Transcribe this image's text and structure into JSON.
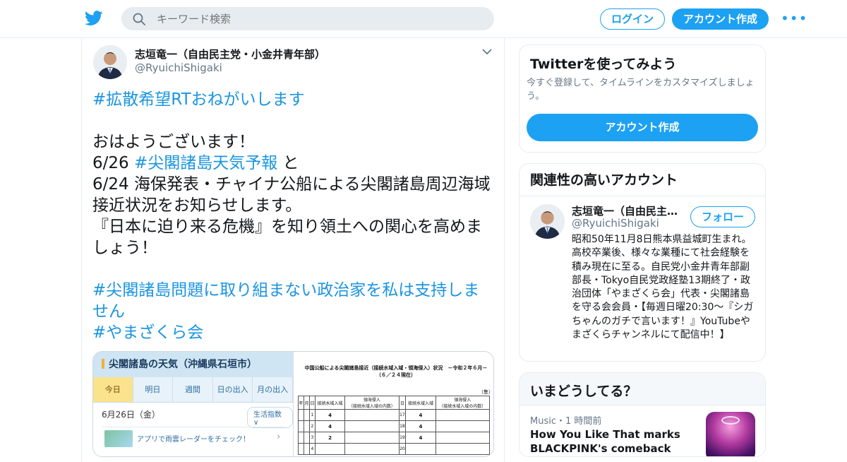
{
  "header": {
    "search_placeholder": "キーワード検索",
    "login_label": "ログイン",
    "signup_label": "アカウント作成",
    "more_label": "•••"
  },
  "tweet": {
    "author_name": "志垣竜一（自由民主党・小金井青年部）",
    "author_handle": "@RyuichiShigaki",
    "lines": [
      {
        "hash": "#拡散希望RTおねがいします",
        "text": ""
      },
      {
        "hash": "",
        "text": "おはようございます！"
      },
      {
        "prefix": "6/26 ",
        "hash": "#尖閣諸島天気予報",
        "suffix": " と"
      },
      {
        "text": "6/24 海保発表・チャイナ公船による尖閣諸島周辺海域"
      },
      {
        "text": "接近状況をお知らせします。"
      },
      {
        "text": "『日本に迫り来る危機』を知り領土への関心を高めま"
      },
      {
        "text": "しょう！"
      },
      {
        "hash": "#尖閣諸島問題に取り組まない政治家を私は支持しま"
      },
      {
        "hash": "せん"
      },
      {
        "hash": "#やまざくら会"
      }
    ]
  },
  "media": {
    "left": {
      "title": "尖閣諸島の天気（沖縄県石垣市）",
      "tabs": [
        "今日",
        "明日",
        "週間",
        "日の出入",
        "月の出入"
      ],
      "date": "6月26日（金）",
      "chip": "生活指数 ∨",
      "radar": "アプリで雨雲レーダーをチェック！"
    },
    "right": {
      "title": "中国公船による尖閣諸島接近（接続水域入域・領海侵入）状況　－令和２年６月－",
      "subtitle": "（６／２４現在）",
      "unit": "（隻）",
      "headers": [
        "年",
        "月",
        "日",
        "接続水域入域",
        "領海侵入",
        "日",
        "接続水域入域",
        "領海侵入"
      ],
      "header_sub": [
        "",
        "",
        "",
        "",
        "（接続水域入域の内数）",
        "",
        "",
        "（接続水域入域の内数）"
      ],
      "rows": [
        [
          "",
          "",
          "1",
          "4",
          "",
          "17",
          "4",
          ""
        ],
        [
          "",
          "",
          "2",
          "4",
          "",
          "18",
          "4",
          ""
        ],
        [
          "",
          "",
          "3",
          "2",
          "",
          "19",
          "4",
          ""
        ],
        [
          "",
          "",
          "4",
          "",
          "",
          "20",
          "",
          ""
        ]
      ]
    }
  },
  "sidebar": {
    "try": {
      "title": "Twitterを使ってみよう",
      "desc": "今すぐ登録して、タイムラインをカスタマイズしましょう。",
      "button": "アカウント作成"
    },
    "related": {
      "title": "関連性の高いアカウント",
      "name": "志垣竜一（自由民主党・小金井青年部）",
      "handle": "@RyuichiShigaki",
      "follow": "フォロー",
      "bio": "昭和50年11月8日熊本県益城町生まれ。高校卒業後、様々な業種にて社会経験を積み現在に至る。自民党小金井青年部副部長・Tokyo自民党政経塾13期終了・政治団体「やまざくら会」代表・尖閣諸島を守る会会員・【毎週日曜20:30〜『シガちゃんのガチで言います！』YouTubeやまざくらチャンネルにて配信中！】"
    },
    "now": {
      "title": "いまどうしてる？",
      "meta": "Music・1 時間前",
      "headline": "How You Like That marks BLACKPINK's comeback"
    }
  },
  "colors": {
    "brand": "#1da1f2",
    "hashtag": "#1b95e0"
  }
}
